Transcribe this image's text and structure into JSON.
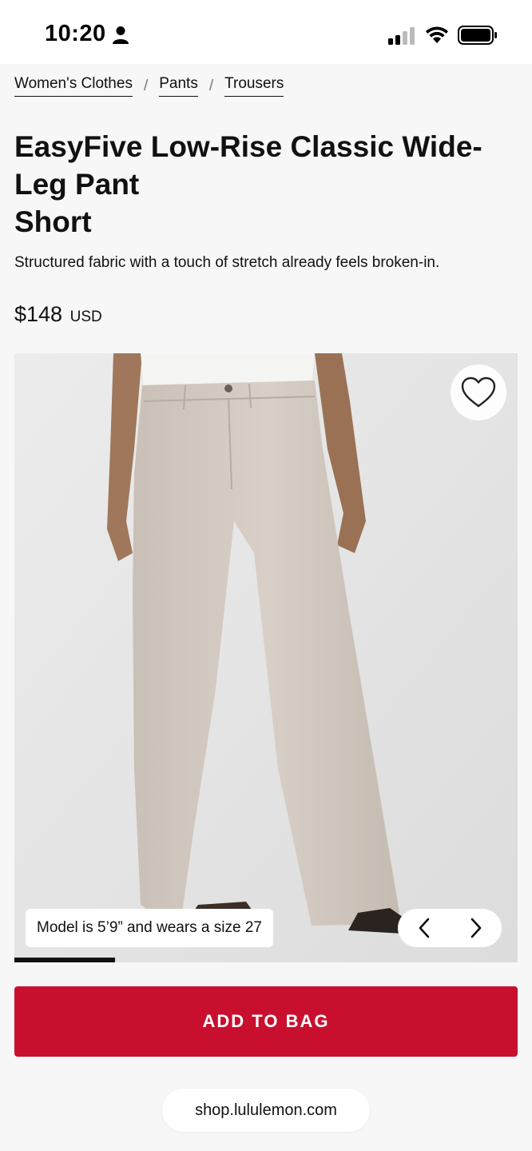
{
  "status_bar": {
    "time": "10:20",
    "icons": [
      "person-icon",
      "cellular-signal-icon",
      "wifi-icon",
      "battery-icon"
    ]
  },
  "breadcrumb": {
    "items": [
      "Women's Clothes",
      "Pants",
      "Trousers"
    ],
    "separator": "/"
  },
  "product": {
    "title": "EasyFive Low-Rise Classic Wide-Leg Pant",
    "subtitle": "Short",
    "description": "Structured fabric with a touch of stretch already feels broken-in.",
    "price": "$148",
    "currency": "USD"
  },
  "gallery": {
    "model_note": "Model is 5’9” and wears a size 27",
    "progress_fraction": 0.2,
    "icons": [
      "heart-icon",
      "chevron-left-icon",
      "chevron-right-icon"
    ]
  },
  "actions": {
    "add_to_bag": "ADD TO BAG"
  },
  "browser": {
    "url": "shop.lululemon.com"
  },
  "colors": {
    "accent": "#c8102e",
    "background": "#f7f7f7",
    "text": "#111111"
  }
}
